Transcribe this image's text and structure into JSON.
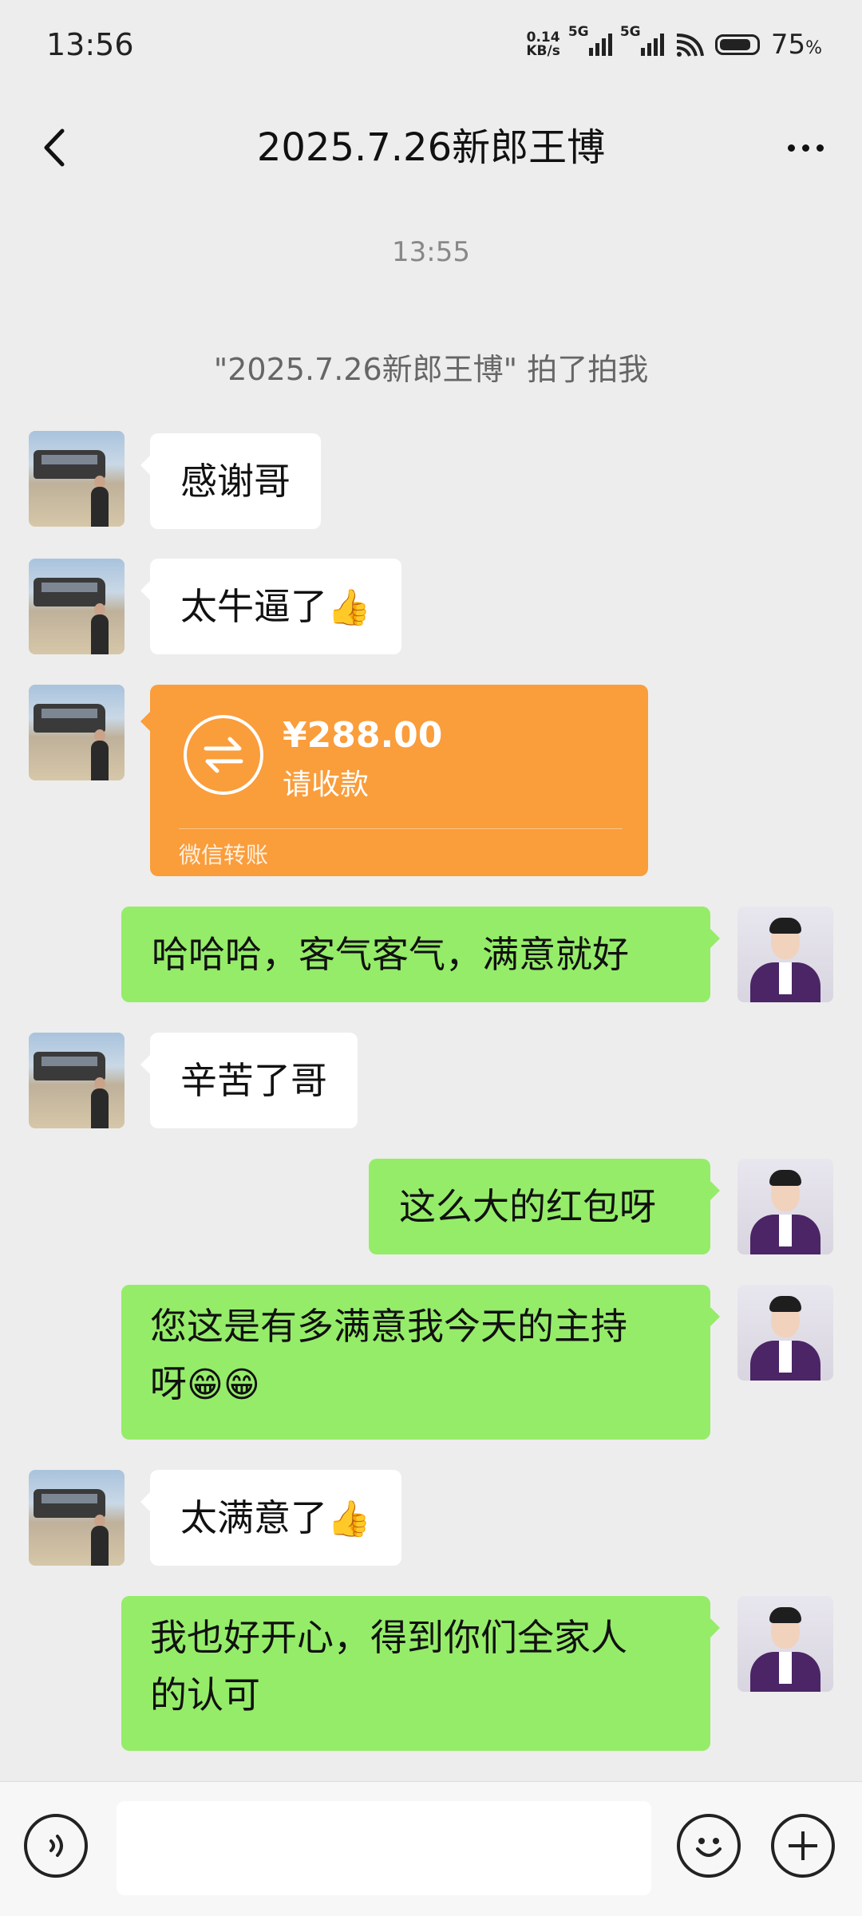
{
  "status_bar": {
    "time": "13:56",
    "net_speed_value": "0.14",
    "net_speed_unit": "KB/s",
    "signal_1": "5G",
    "signal_2": "5G",
    "battery_percent": "75",
    "battery_unit": "%"
  },
  "header": {
    "title": "2025.7.26新郎王博",
    "back_icon": "chevron-left-icon",
    "more_icon": "more-dots-icon"
  },
  "system": {
    "time": "13:55",
    "pat_notice": "\"2025.7.26新郎王博\" 拍了拍我"
  },
  "messages": [
    {
      "side": "in",
      "text": "感谢哥"
    },
    {
      "side": "in",
      "text": "太牛逼了",
      "emoji": "👍"
    },
    {
      "side": "in",
      "type": "transfer",
      "amount": "¥288.00",
      "status": "请收款",
      "footer": "微信转账"
    },
    {
      "side": "out",
      "text": "哈哈哈，客气客气，满意就好"
    },
    {
      "side": "in",
      "text": "辛苦了哥"
    },
    {
      "side": "out",
      "text": "这么大的红包呀"
    },
    {
      "side": "out",
      "text_line1": "您这是有多满意我今天的主持",
      "text_line2": "呀",
      "emoji": "😁😁"
    },
    {
      "side": "in",
      "text": "太满意了",
      "emoji": "👍"
    },
    {
      "side": "out",
      "text_line1": "我也好开心，得到你们全家人",
      "text_line2": "的认可"
    }
  ],
  "colors": {
    "incoming_bubble": "#ffffff",
    "outgoing_bubble": "#95ec69",
    "transfer_card": "#fa9d3b",
    "background": "#ededed"
  },
  "input_bar": {
    "placeholder": "",
    "voice_icon": "voice-icon",
    "emoji_icon": "emoji-icon",
    "plus_icon": "plus-icon"
  }
}
